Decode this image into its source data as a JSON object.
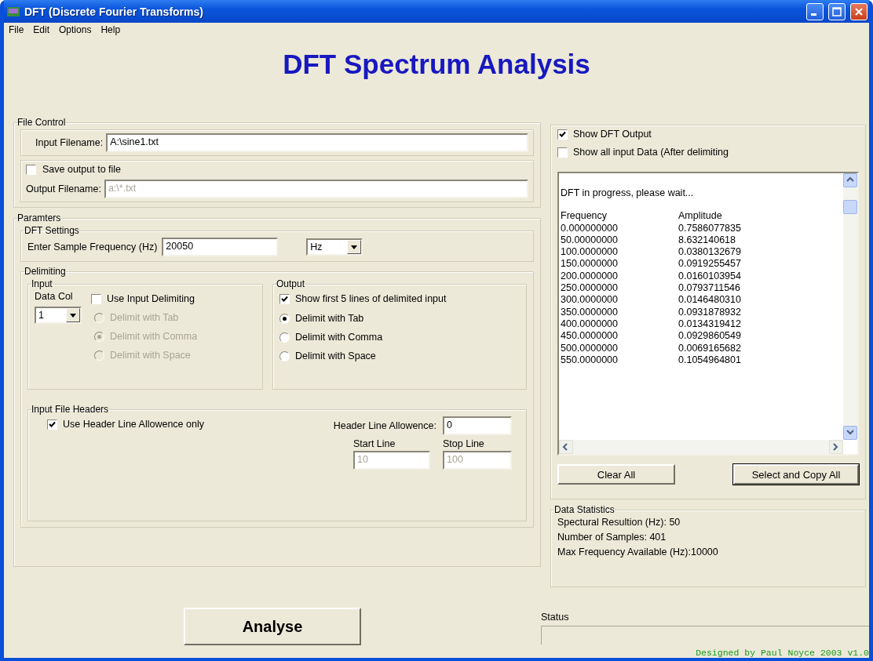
{
  "window": {
    "title": "DFT (Discrete Fourier Transforms)"
  },
  "menu": [
    "File",
    "Edit",
    "Options",
    "Help"
  ],
  "heading": "DFT Spectrum Analysis",
  "file_control": {
    "title": "File Control",
    "input_label": "Input Filename:",
    "input_value": "A:\\sine1.txt",
    "save": {
      "label": "Save output to file",
      "checked": false
    },
    "output_label": "Output Filename:",
    "output_value": "a:\\*.txt",
    "output_disabled": true
  },
  "parameters": {
    "title": "Paramters",
    "dft_settings": {
      "title": "DFT Settings",
      "label": "Enter Sample Frequency (Hz)",
      "value": "20050",
      "unit": "Hz"
    },
    "delimiting": {
      "title": "Delimiting",
      "input": {
        "title": "Input",
        "data_col_label": "Data Col",
        "data_col_value": "1",
        "use": {
          "label": "Use Input Delimiting",
          "checked": false
        },
        "options": [
          {
            "label": "Delimit with Tab",
            "selected": false,
            "disabled": true
          },
          {
            "label": "Delimit with Comma",
            "selected": true,
            "disabled": true
          },
          {
            "label": "Delimit with Space",
            "selected": false,
            "disabled": true
          }
        ]
      },
      "output": {
        "title": "Output",
        "show_first": {
          "label": "Show first 5 lines of delimited  input",
          "checked": true
        },
        "options": [
          {
            "label": "Delimit with Tab",
            "selected": true,
            "disabled": false
          },
          {
            "label": "Delimit with Comma",
            "selected": false,
            "disabled": false
          },
          {
            "label": "Delimit with Space",
            "selected": false,
            "disabled": false
          }
        ]
      }
    },
    "headers": {
      "title": "Input File Headers",
      "use": {
        "label": "Use Header Line Allowence only",
        "checked": true
      },
      "allowance_label": "Header Line Allowence:",
      "allowance_value": "0",
      "start_label": "Start Line",
      "start_value": "10",
      "stop_label": "Stop Line",
      "stop_value": "100",
      "range_disabled": true
    }
  },
  "analyse_button": "Analyse",
  "output_panel": {
    "checkboxes": [
      {
        "label": "Show DFT Output",
        "checked": true
      },
      {
        "label": "Show all input Data (After delimiting",
        "checked": false
      }
    ],
    "message": "DFT in progress, please wait...",
    "columns": [
      "Frequency",
      "Amplitude"
    ],
    "rows": [
      [
        "0.000000000",
        "0.7586077835"
      ],
      [
        "50.00000000",
        "8.632140618"
      ],
      [
        "100.0000000",
        "0.0380132679"
      ],
      [
        "150.0000000",
        "0.0919255457"
      ],
      [
        "200.0000000",
        "0.0160103954"
      ],
      [
        "250.0000000",
        "0.0793711546"
      ],
      [
        "300.0000000",
        "0.0146480310"
      ],
      [
        "350.0000000",
        "0.0931878932"
      ],
      [
        "400.0000000",
        "0.0134319412"
      ],
      [
        "450.0000000",
        "0.0929860549"
      ],
      [
        "500.0000000",
        "0.0069165682"
      ],
      [
        "550.0000000",
        "0.1054964801"
      ]
    ],
    "buttons": [
      {
        "label": "Clear All",
        "focused": false
      },
      {
        "label": "Select and Copy All",
        "focused": true
      }
    ]
  },
  "statistics": {
    "title": "Data Statistics",
    "lines": [
      "Spectural Resultion (Hz): 50",
      "Number of Samples: 401",
      "Max Frequency Available (Hz):10000"
    ]
  },
  "status": {
    "label": "Status"
  },
  "credit": "Designed by Paul Noyce 2003 v1.0"
}
